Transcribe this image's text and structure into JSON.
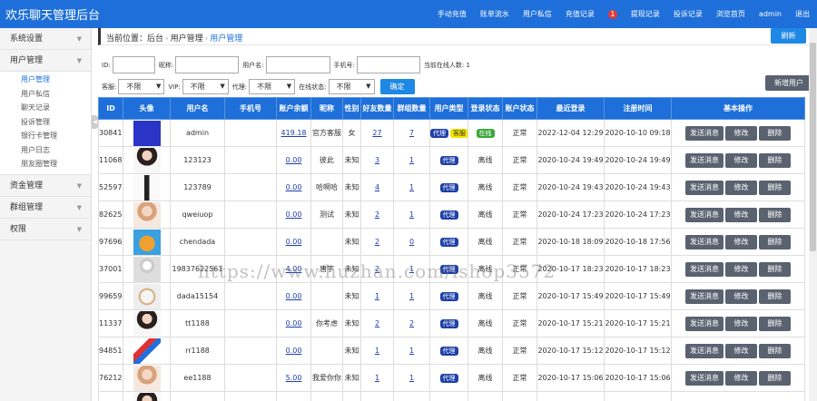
{
  "app": {
    "brand": "欢乐聊天管理后台",
    "nav": [
      {
        "label": "手动充值"
      },
      {
        "label": "账单流水"
      },
      {
        "label": "用户私信"
      },
      {
        "label": "充值记录",
        "badge": "1"
      },
      {
        "label": "提现记录"
      },
      {
        "label": "投诉记录"
      },
      {
        "label": "浏览首页"
      },
      {
        "label": "admin"
      },
      {
        "label": "退出"
      }
    ]
  },
  "sidebar": {
    "groups": [
      {
        "label": "系统设置"
      },
      {
        "label": "用户管理",
        "items": [
          "用户管理",
          "用户私信",
          "聊天记录",
          "投诉管理",
          "银行卡管理",
          "用户日志",
          "朋友圈管理"
        ]
      },
      {
        "label": "资金管理"
      },
      {
        "label": "群组管理"
      },
      {
        "label": "权限"
      }
    ]
  },
  "breadcrumb": {
    "prefix": "当前位置：",
    "items": [
      "后台",
      "用户管理",
      "用户管理"
    ],
    "refresh_label": "刷新"
  },
  "filters": {
    "id_label": "ID:",
    "nickname_label": "昵称:",
    "username_label": "用户名:",
    "phone_label": "手机号:",
    "online_count": "当前在线人数: 1",
    "service_label": "客服:",
    "service_value": "不限",
    "vip_label": "VIP:",
    "vip_value": "不限",
    "agent_label": "代理:",
    "agent_value": "不限",
    "status_label": "在线状态:",
    "status_value": "不限",
    "confirm_label": "确定",
    "new_user_label": "新增用户"
  },
  "table": {
    "columns": [
      "ID",
      "头像",
      "用户名",
      "手机号",
      "账户余额",
      "昵称",
      "性别",
      "好友数量",
      "群组数量",
      "用户类型",
      "登录状态",
      "账户状态",
      "最近登录",
      "注册时间",
      "基本操作"
    ],
    "actions": {
      "send": "发送消息",
      "edit": "修改",
      "del": "删除"
    },
    "rows": [
      {
        "id": "30841",
        "avatar": "blue",
        "username": "admin",
        "phone": "",
        "balance": "419.18",
        "nickname": "官方客服",
        "gender": "女",
        "friends": "27",
        "groups": "7",
        "types": [
          "代理",
          "客服"
        ],
        "login": "在线",
        "status": "正常",
        "last_login": "2022-12-04 12:29",
        "registered": "2020-10-10 09:18"
      },
      {
        "id": "11068",
        "avatar": "girl-dark",
        "username": "123123",
        "phone": "",
        "balance": "0.00",
        "nickname": "彼此",
        "gender": "未知",
        "friends": "3",
        "groups": "1",
        "types": [
          "代理"
        ],
        "login": "离线",
        "status": "正常",
        "last_login": "2020-10-24 19:49",
        "registered": "2020-10-24 19:49"
      },
      {
        "id": "52597",
        "avatar": "figure",
        "username": "123789",
        "phone": "",
        "balance": "0.00",
        "nickname": "哈啊哈",
        "gender": "未知",
        "friends": "4",
        "groups": "1",
        "types": [
          "代理"
        ],
        "login": "离线",
        "status": "正常",
        "last_login": "2020-10-24 19:43",
        "registered": "2020-10-24 19:43"
      },
      {
        "id": "82625",
        "avatar": "girl-light",
        "username": "qweiuop",
        "phone": "",
        "balance": "0.00",
        "nickname": "测试",
        "gender": "未知",
        "friends": "2",
        "groups": "1",
        "types": [
          "代理"
        ],
        "login": "离线",
        "status": "正常",
        "last_login": "2020-10-24 17:23",
        "registered": "2020-10-24 17:23"
      },
      {
        "id": "97696",
        "avatar": "cartoon",
        "username": "chendada",
        "phone": "",
        "balance": "0.00",
        "nickname": "",
        "gender": "未知",
        "friends": "2",
        "groups": "0",
        "types": [
          "代理"
        ],
        "login": "离线",
        "status": "正常",
        "last_login": "2020-10-18 18:09",
        "registered": "2020-10-18 17:56"
      },
      {
        "id": "37001",
        "avatar": "default",
        "username": "19837622561",
        "phone": "",
        "balance": "4.00",
        "nickname": "唐宇",
        "gender": "未知",
        "friends": "2",
        "groups": "1",
        "types": [
          "代理"
        ],
        "login": "离线",
        "status": "正常",
        "last_login": "2020-10-17 18:23",
        "registered": "2020-10-17 18:23"
      },
      {
        "id": "99659",
        "avatar": "cat",
        "username": "dada15154",
        "phone": "",
        "balance": "0.00",
        "nickname": "",
        "gender": "未知",
        "friends": "1",
        "groups": "1",
        "types": [
          "代理"
        ],
        "login": "离线",
        "status": "正常",
        "last_login": "2020-10-17 15:49",
        "registered": "2020-10-17 15:49"
      },
      {
        "id": "11337",
        "avatar": "girl-dark",
        "username": "tt1188",
        "phone": "",
        "balance": "0.00",
        "nickname": "你考虑",
        "gender": "未知",
        "friends": "2",
        "groups": "2",
        "types": [
          "代理"
        ],
        "login": "离线",
        "status": "正常",
        "last_login": "2020-10-17 15:21",
        "registered": "2020-10-17 15:21"
      },
      {
        "id": "94851",
        "avatar": "rocket",
        "username": "rr1188",
        "phone": "",
        "balance": "0.00",
        "nickname": "",
        "gender": "未知",
        "friends": "1",
        "groups": "1",
        "types": [
          "代理"
        ],
        "login": "离线",
        "status": "正常",
        "last_login": "2020-10-17 15:12",
        "registered": "2020-10-17 15:12"
      },
      {
        "id": "76212",
        "avatar": "girl-light",
        "username": "ee1188",
        "phone": "",
        "balance": "5.00",
        "nickname": "我爱你你",
        "gender": "未知",
        "friends": "1",
        "groups": "1",
        "types": [
          "代理"
        ],
        "login": "离线",
        "status": "正常",
        "last_login": "2020-10-17 15:06",
        "registered": "2020-10-17 15:06"
      },
      {
        "id": "",
        "avatar": "girl-dark",
        "username": "",
        "phone": "",
        "balance": "",
        "nickname": "",
        "gender": "",
        "friends": "",
        "groups": "",
        "types": [],
        "login": "",
        "status": "",
        "last_login": "",
        "registered": ""
      }
    ]
  },
  "watermark": "https://www.huzhan.com/ishop3572",
  "colors": {
    "primary": "#1e6fd9",
    "button_dark": "#5a6270",
    "online": "#3aa53a",
    "service": "#f5e400",
    "agent": "#1e3fa8"
  }
}
